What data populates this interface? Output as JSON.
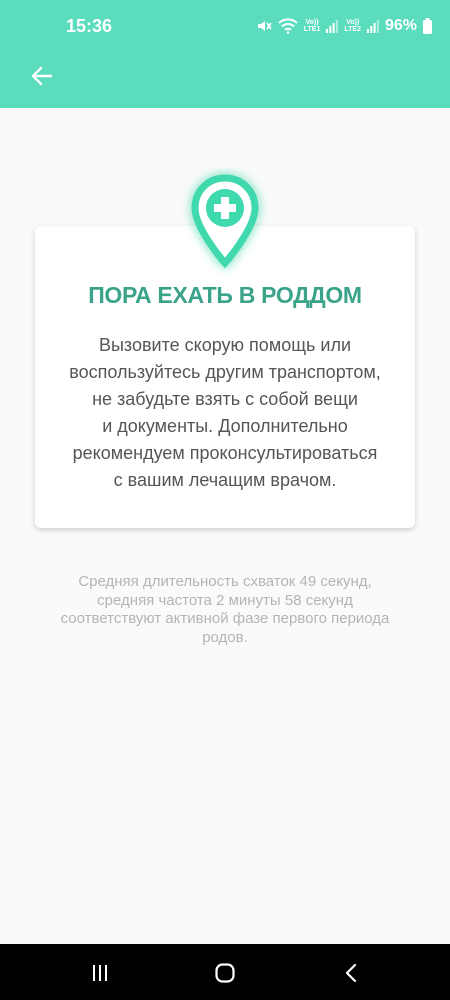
{
  "status_bar": {
    "time": "15:36",
    "sim1": {
      "top": "Vo))",
      "bottom": "LTE1"
    },
    "sim2": {
      "top": "Vo))",
      "bottom": "LTE2"
    },
    "battery": "96%",
    "icons": [
      "mute-icon",
      "wifi-icon",
      "signal-icon",
      "battery-icon"
    ]
  },
  "app_bar": {
    "back_icon": "arrow-left-icon",
    "color": "#5bdcbc"
  },
  "card": {
    "icon": "medical-location-pin-icon",
    "title": "ПОРА ЕХАТЬ В РОДДОМ",
    "title_color": "#3aa38a",
    "body_lines": [
      "Вызовите скорую помощь или",
      "воспользуйтесь другим транспортом,",
      "не забудьте взять с собой вещи",
      "и документы. Дополнительно",
      "рекомендуем проконсультироваться",
      "с вашим лечащим врачом."
    ]
  },
  "note": {
    "lines": [
      "Средняя длительность схваток 49 секунд,",
      "средняя частота 2 минуты 58 секунд",
      "соответствуют активной фазе первого периода",
      "родов."
    ]
  },
  "nav_bar": {
    "items": [
      "recent-apps-icon",
      "home-icon",
      "back-icon"
    ]
  }
}
